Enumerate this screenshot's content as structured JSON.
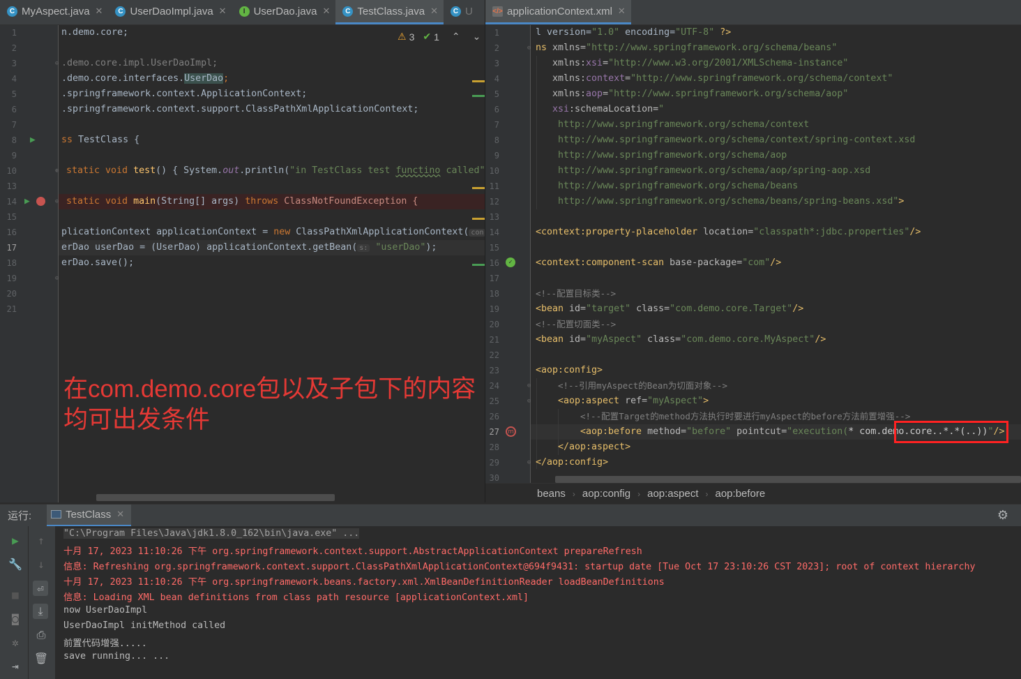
{
  "left_tabs": [
    {
      "label": "MyAspect.java",
      "icon": "c"
    },
    {
      "label": "UserDaoImpl.java",
      "icon": "c"
    },
    {
      "label": "UserDao.java",
      "icon": "i"
    },
    {
      "label": "TestClass.java",
      "icon": "c",
      "active": true
    },
    {
      "label": "U",
      "icon": "c"
    }
  ],
  "right_tabs": [
    {
      "label": "applicationContext.xml",
      "icon": "x",
      "active": true
    }
  ],
  "inspections": {
    "warnings": "3",
    "weak": "1"
  },
  "java_lines": [
    "1",
    "2",
    "3",
    "4",
    "5",
    "6",
    "7",
    "8",
    "9",
    "10",
    "13",
    "14",
    "15",
    "16",
    "17",
    "18",
    "19",
    "20",
    "21"
  ],
  "java_code": {
    "l1": "n.demo.core;",
    "l3": ".demo.core.impl.UserDaoImpl;",
    "l4a": ".demo.core.interfaces.",
    "l4b": "UserDao",
    "l4c": ";",
    "l5": ".springframework.context.ApplicationContext;",
    "l6": ".springframework.context.support.ClassPathXmlApplicationContext;",
    "l8a": "ss ",
    "l8b": "TestClass {",
    "l10a": "static void ",
    "l10b": "test",
    "l10c": "() { System.",
    "l10d": "out",
    "l10e": ".println(",
    "l10f": "\"in TestClass test ",
    "l10g": "functino",
    "l10h": " called\"",
    "l14a": "static void ",
    "l14b": "main",
    "l14c": "(String[] args) ",
    "l14d": "throws ",
    "l14e": "ClassNotFoundException {",
    "l16a": "plicationContext applicationContext = ",
    "l16b": "new ",
    "l16c": "ClassPathXmlApplicationContext(",
    "l16d": "con",
    "l17a": "erDao userDao = (UserDao) applicationContext.getBean(",
    "l17b": "s:",
    "l17c": "\"userDao\"",
    "l17d": ");",
    "l18": "erDao.save();"
  },
  "annotation": {
    "line1": "在com.demo.core包以及子包下的内容",
    "line2": "均可出发条件"
  },
  "xml_lines": [
    "1",
    "2",
    "3",
    "4",
    "5",
    "6",
    "7",
    "8",
    "9",
    "10",
    "11",
    "12",
    "13",
    "14",
    "15",
    "16",
    "17",
    "18",
    "19",
    "20",
    "21",
    "22",
    "23",
    "24",
    "25",
    "26",
    "27",
    "28",
    "29",
    "30"
  ],
  "xml_code": {
    "x1a": "l version=",
    "x1b": "\"1.0\"",
    "x1c": " encoding=",
    "x1d": "\"UTF-8\"",
    "x1e": " ?>",
    "x2a": "ns ",
    "x2b": "xmlns=",
    "x2c": "\"http://www.springframework.org/schema/beans\"",
    "x3a": "xmlns:",
    "x3b": "xsi",
    "x3c": "=",
    "x3d": "\"http://www.w3.org/2001/XMLSchema-instance\"",
    "x4a": "xmlns:",
    "x4b": "context",
    "x4c": "=",
    "x4d": "\"http://www.springframework.org/schema/context\"",
    "x5a": "xmlns:",
    "x5b": "aop",
    "x5c": "=",
    "x5d": "\"http://www.springframework.org/schema/aop\"",
    "x6a": "xsi",
    "x6b": ":schemaLocation=",
    "x6c": "\"",
    "x7": "http://www.springframework.org/schema/context",
    "x8": "http://www.springframework.org/schema/context/spring-context.xsd",
    "x9": "http://www.springframework.org/schema/aop",
    "x10": "http://www.springframework.org/schema/aop/spring-aop.xsd",
    "x11": "http://www.springframework.org/schema/beans",
    "x12a": "http://www.springframework.org/schema/beans/spring-beans.xsd\"",
    "x12b": ">",
    "x14a": "<context:property-placeholder ",
    "x14b": "location=",
    "x14c": "\"classpath*:jdbc.properties\"",
    "x14d": "/>",
    "x16a": "<context:component-scan ",
    "x16b": "base-package=",
    "x16c": "\"com\"",
    "x16d": "/>",
    "x18": "<!--配置目标类-->",
    "x19a": "<bean ",
    "x19b": "id=",
    "x19c": "\"target\"",
    "x19d": " class=",
    "x19e": "\"com.demo.core.Target\"",
    "x19f": "/>",
    "x20": "<!--配置切面类-->",
    "x21a": "<bean ",
    "x21b": "id=",
    "x21c": "\"myAspect\"",
    "x21d": " class=",
    "x21e": "\"com.demo.core.MyAspect\"",
    "x21f": "/>",
    "x23": "<aop:config>",
    "x24": "<!--引用myAspect的Bean为切面对象-->",
    "x25a": "<aop:aspect ",
    "x25b": "ref=",
    "x25c": "\"myAspect\"",
    "x25d": ">",
    "x26": "<!--配置Target的method方法执行时要进行myAspect的before方法前置增强-->",
    "x27a": "<aop:before ",
    "x27b": "method=",
    "x27c": "\"before\"",
    "x27d": " pointcut=",
    "x27e": "\"execution(",
    "x27f": "* com.demo.core..*.*(..))",
    "x27g": "\"",
    "x27h": "/>",
    "x28": "</aop:aspect>",
    "x29": "</aop:config>"
  },
  "breadcrumbs": [
    "beans",
    "aop:config",
    "aop:aspect",
    "aop:before"
  ],
  "run": {
    "label": "运行:",
    "tab": "TestClass"
  },
  "console": [
    {
      "text": "\"C:\\Program Files\\Java\\jdk1.8.0_162\\bin\\java.exe\" ...",
      "kind": "cmd"
    },
    {
      "text": "十月 17, 2023 11:10:26 下午 org.springframework.context.support.AbstractApplicationContext prepareRefresh",
      "kind": "err"
    },
    {
      "text": "信息: Refreshing org.springframework.context.support.ClassPathXmlApplicationContext@694f9431: startup date [Tue Oct 17 23:10:26 CST 2023]; root of context hierarchy",
      "kind": "err"
    },
    {
      "text": "十月 17, 2023 11:10:26 下午 org.springframework.beans.factory.xml.XmlBeanDefinitionReader loadBeanDefinitions",
      "kind": "err"
    },
    {
      "text": "信息: Loading XML bean definitions from class path resource [applicationContext.xml]",
      "kind": "err"
    },
    {
      "text": "now UserDaoImpl",
      "kind": "out"
    },
    {
      "text": "UserDaoImpl initMethod called",
      "kind": "out"
    },
    {
      "text": "前置代码增强.....",
      "kind": "out"
    },
    {
      "text": "save running... ...",
      "kind": "out"
    }
  ],
  "colors": {
    "accent": "#4a88c7",
    "error": "#ff6b68",
    "annotation": "#e53935",
    "highlight_box": "#ff2222"
  }
}
